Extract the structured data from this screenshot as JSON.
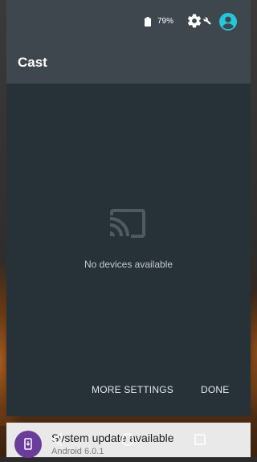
{
  "status_bar": {
    "battery_percent": "79%",
    "accent_color": "#26c6da"
  },
  "dialog": {
    "title": "Cast",
    "empty_message": "No devices available",
    "more_settings_label": "MORE SETTINGS",
    "done_label": "DONE",
    "icon": "cast-icon"
  },
  "notification": {
    "title": "System update available",
    "subtitle": "Android 6.0.1",
    "icon": "system-update-icon",
    "icon_color": "#6a3d9a"
  },
  "navigation": {
    "back": "back-icon",
    "home": "home-icon",
    "recents": "recents-icon"
  }
}
